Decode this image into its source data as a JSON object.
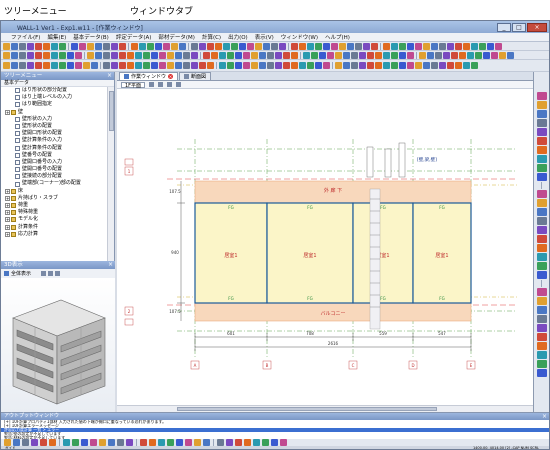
{
  "callouts": {
    "tree_menu": "ツリーメニュー",
    "window_tab": "ウィンドウタブ"
  },
  "window": {
    "title": "WALL-1 Ver1 - Exp1.w11 - [作業ウィンドウ]",
    "minimize": "_",
    "maximize": "□",
    "close": "×"
  },
  "menu": [
    "ファイル(F)",
    "編集(E)",
    "基本データ(B)",
    "評定データ(A)",
    "部材データ(M)",
    "計算(C)",
    "出力(O)",
    "表示(V)",
    "ウィンドウ(W)",
    "ヘルプ(H)"
  ],
  "left_panel": {
    "title": "ツリーメニュー",
    "close": "×",
    "root": "基本データ",
    "items": [
      {
        "label": "はり形状の部分配置",
        "kind": "leaf"
      },
      {
        "label": "はり上端レベルの入力",
        "kind": "leaf"
      },
      {
        "label": "はり範囲指定",
        "kind": "leaf"
      },
      {
        "label": "壁",
        "kind": "folder"
      },
      {
        "label": "壁形状の入力",
        "kind": "leaf"
      },
      {
        "label": "壁形状の配置",
        "kind": "leaf"
      },
      {
        "label": "壁開口形状の配置",
        "kind": "leaf"
      },
      {
        "label": "壁計算条件の入力",
        "kind": "leaf"
      },
      {
        "label": "壁計算条件の配置",
        "kind": "leaf"
      },
      {
        "label": "壁番号の配置",
        "kind": "leaf"
      },
      {
        "label": "壁開口番号の入力",
        "kind": "leaf"
      },
      {
        "label": "壁開口番号の配置",
        "kind": "leaf"
      },
      {
        "label": "壁接続の部分配置",
        "kind": "leaf"
      },
      {
        "label": "壁端部(コーナー)部の配置",
        "kind": "leaf"
      },
      {
        "label": "床",
        "kind": "folder"
      },
      {
        "label": "片持ばり・スラブ",
        "kind": "folder"
      },
      {
        "label": "荷重",
        "kind": "folder"
      },
      {
        "label": "特殊荷重",
        "kind": "folder"
      },
      {
        "label": "モデル化",
        "kind": "folder"
      },
      {
        "label": "計算条件",
        "kind": "folder"
      },
      {
        "label": "応力計算",
        "kind": "folder"
      }
    ]
  },
  "view3d": {
    "title": "3D表示",
    "close": "×",
    "tool_label": "全体表示"
  },
  "tabs": [
    {
      "label": "作業ウィンドウ",
      "active": true
    },
    {
      "label": "断面図",
      "active": false
    }
  ],
  "subtab": "1F平面",
  "drawing": {
    "top_band": "外 廊 下",
    "bottom_band": "バルコニー",
    "rooms": [
      "居室1",
      "居室1",
      "居室1",
      "居室1"
    ],
    "fg_label": "FG",
    "dims_bottom": [
      "601",
      "708",
      "559",
      "547"
    ],
    "total_dim": "2616",
    "left_dims": [
      "107.5",
      "940",
      "107.5"
    ],
    "leg_top": "[壁,梁,壁]",
    "grid_letters": [
      "A",
      "B",
      "C",
      "D",
      "E"
    ],
    "grid_numbers": [
      "1",
      "2"
    ]
  },
  "output": {
    "title": "アウトプットウィンドウ",
    "lines": [
      "[+] 10F計算プロパティ1部材 入力された値の下端が開口に重なっている恐れがあります。",
      "[+] 10F計算エラーメッセージ",
      "許容応力度計算 一覧 > エラー",
      "警告:壁の設定が不足しています",
      "警告:材料の設定が不足しています",
      "Warning:Tシリのデータは存在しませんでした。"
    ],
    "selected_index": 2
  },
  "status": {
    "left": "ガイド",
    "right": "1400.00, 4014.00 [2] -CAP NUM SCRL"
  }
}
